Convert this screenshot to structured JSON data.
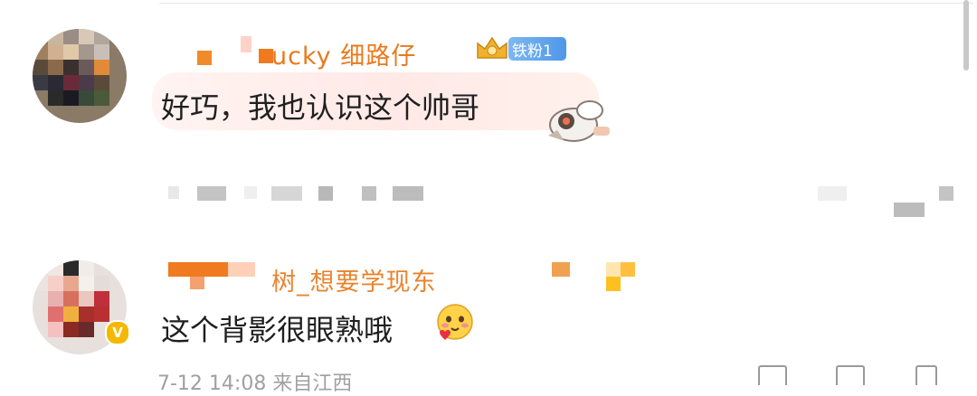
{
  "comment1": {
    "username": "ucky 细路仔",
    "fan_badge": "铁粉1",
    "text": "好巧，我也认识这个帅哥",
    "sticker_icon": "astronaut-sticker-icon"
  },
  "comment2": {
    "username": "树_想要学现东",
    "text": "这个背影很眼熟哦",
    "emoji_icon": "blushing-face-with-heart-icon",
    "verified_icon": "verified-badge-icon"
  },
  "footer": {
    "timestamp_partial": "7-12 14:08 来自江西"
  },
  "colors": {
    "username": "#e87a1d",
    "fan_badge": "#5aa2ee",
    "bubble": "#ffe9e6",
    "text": "#1f1f1f"
  }
}
